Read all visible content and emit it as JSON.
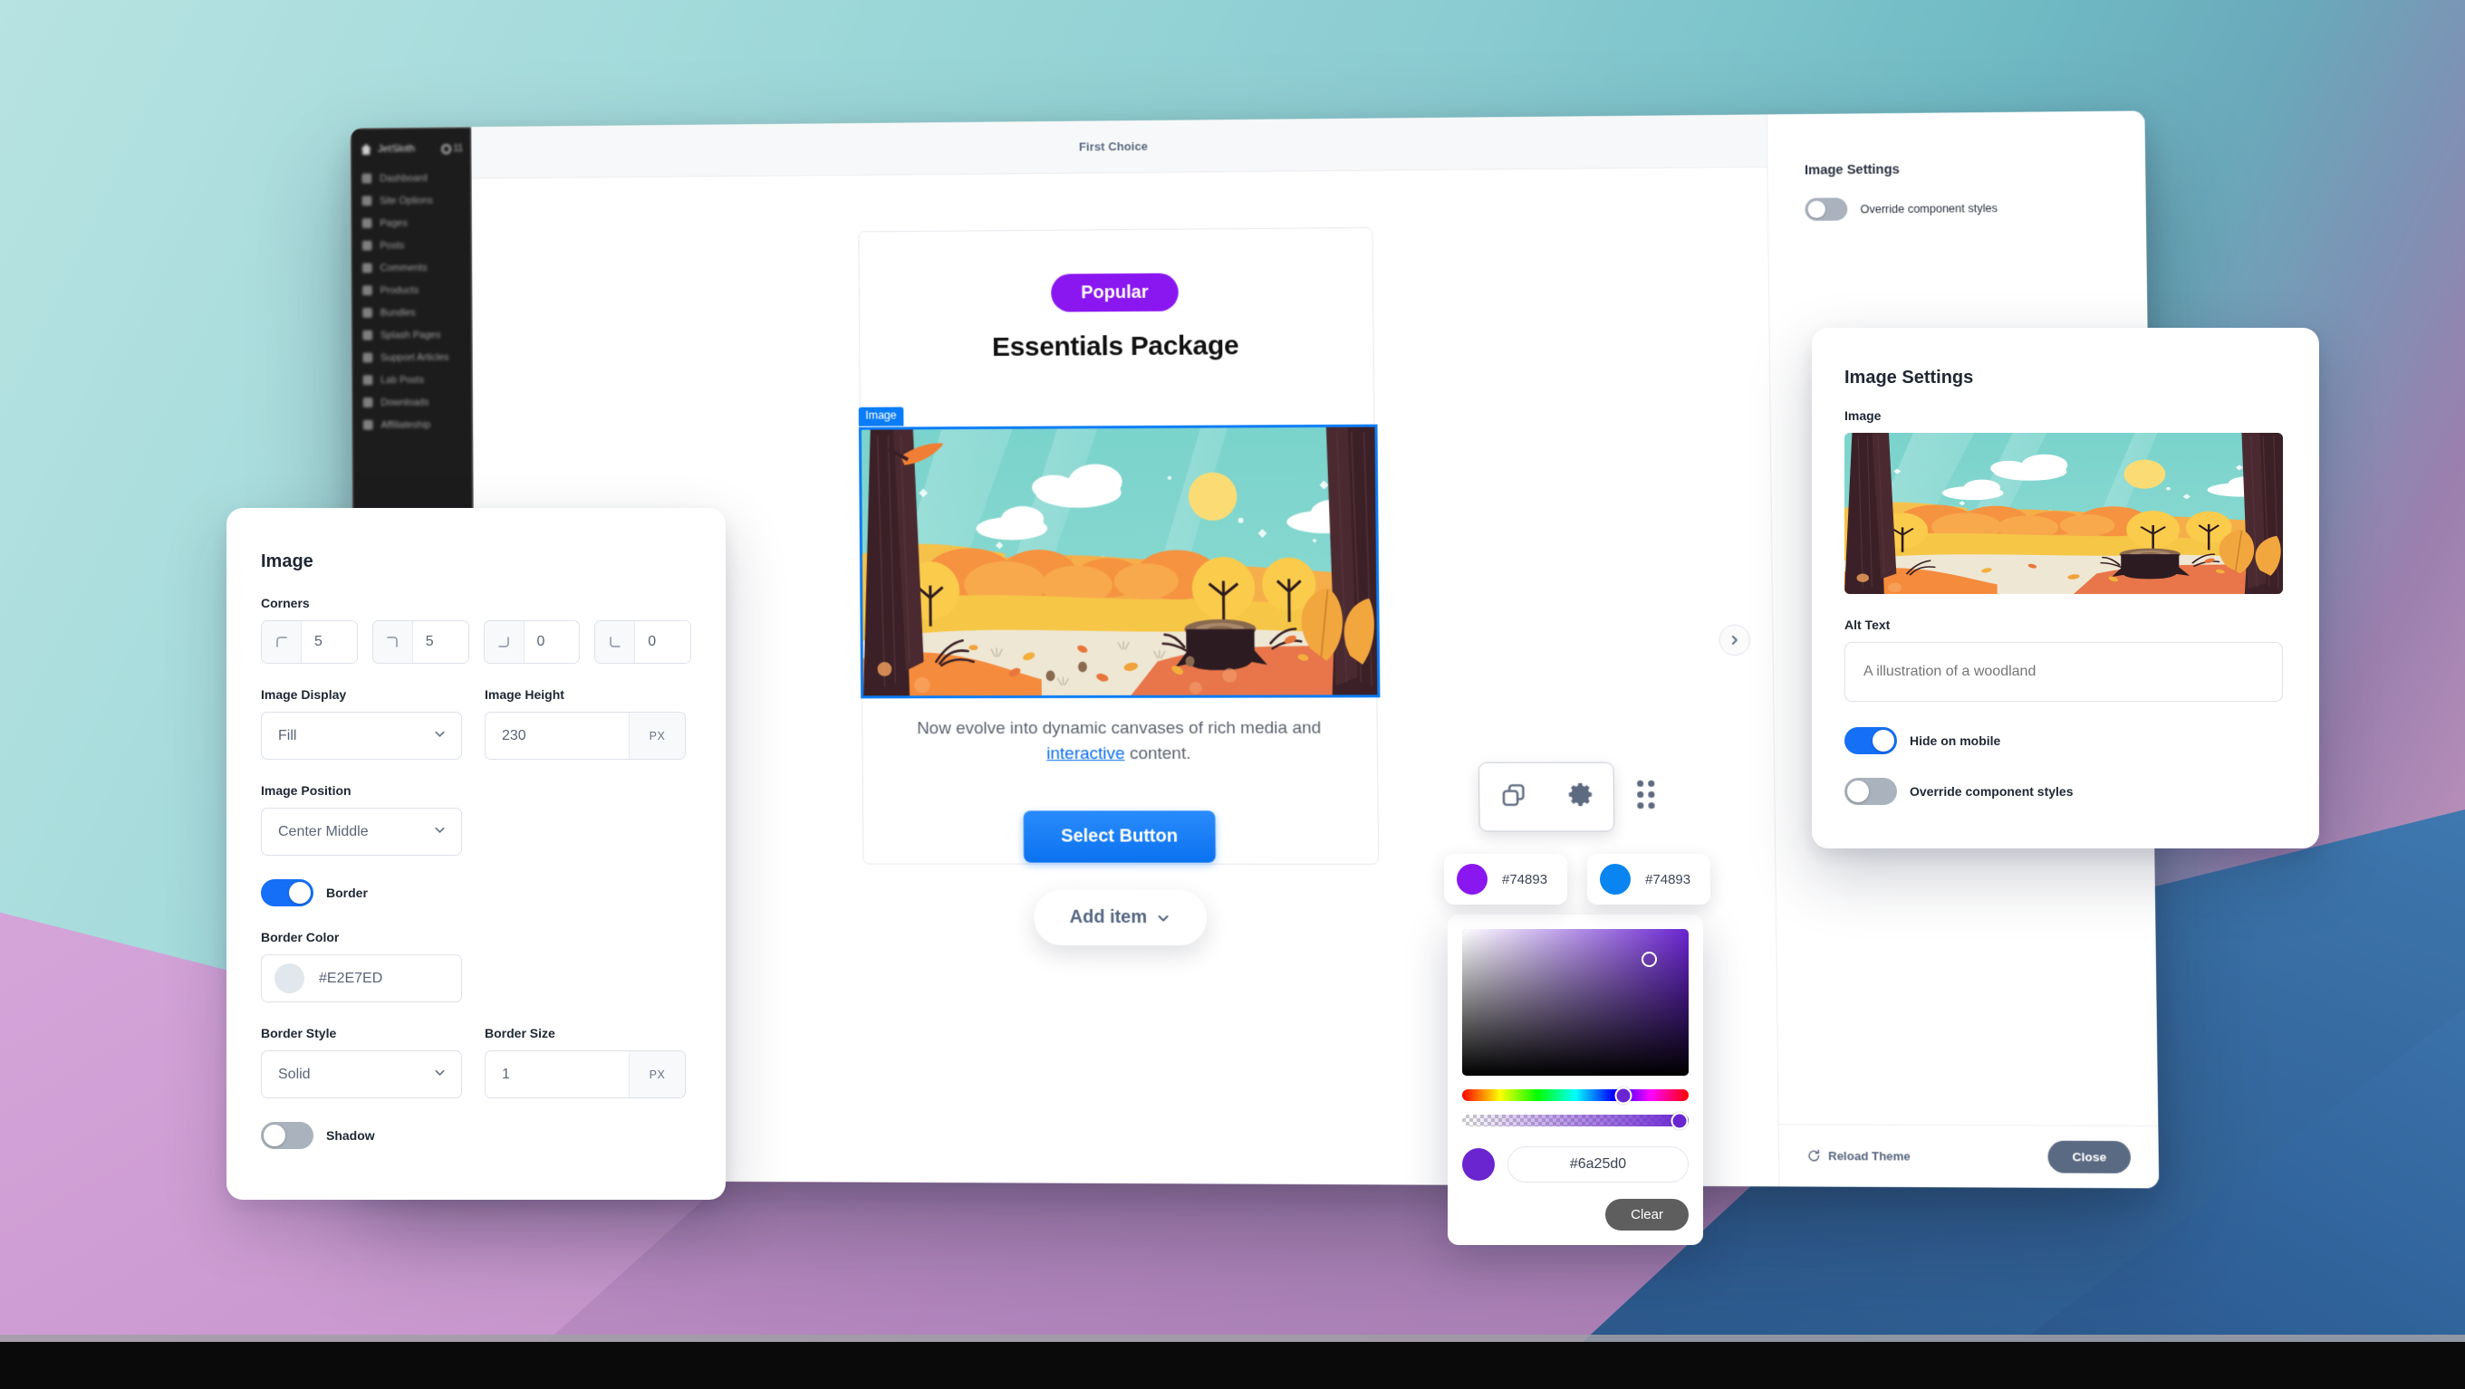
{
  "sidebar": {
    "brand": "JetSloth",
    "notification_count": "11",
    "items": [
      {
        "label": "Dashboard",
        "icon": "dashboard-icon"
      },
      {
        "label": "Site Options",
        "icon": "gear-icon"
      },
      {
        "label": "Pages",
        "icon": "page-icon"
      },
      {
        "label": "Posts",
        "icon": "pencil-icon"
      },
      {
        "label": "Comments",
        "icon": "comment-icon"
      },
      {
        "label": "Products",
        "icon": "cart-icon"
      },
      {
        "label": "Bundles",
        "icon": "box-icon"
      },
      {
        "label": "Splash Pages",
        "icon": "columns-icon"
      },
      {
        "label": "Support Articles",
        "icon": "lifebuoy-icon"
      },
      {
        "label": "Lab Posts",
        "icon": "flask-icon"
      },
      {
        "label": "Downloads",
        "icon": "download-icon"
      },
      {
        "label": "Affiliateship",
        "icon": "person-icon"
      }
    ]
  },
  "canvas": {
    "header_title": "First Choice",
    "card": {
      "badge": "Popular",
      "title": "Essentials Package",
      "image_tag": "Image",
      "body_before_link": "Now evolve into dynamic canvases of rich media and ",
      "body_link": "interactive",
      "body_after_link": " content.",
      "button": "Select Button"
    },
    "add_item": "Add item",
    "add_item_chevron": "chevron-down-icon",
    "trash_icon": "trash-icon",
    "pager_icon": "chevron-right-icon",
    "toolbar": {
      "copy_icon": "copy-icon",
      "settings_icon": "gear-icon",
      "drag_handle_icon": "drag-dots-icon"
    }
  },
  "rail": {
    "title": "Image Settings",
    "override_toggle": {
      "label": "Override component styles",
      "state": "off"
    },
    "reload_theme": "Reload Theme",
    "reload_icon": "refresh-icon",
    "close": "Close"
  },
  "image_panel": {
    "title": "Image",
    "corners_label": "Corners",
    "corners": [
      {
        "icon": "corner-top-left-icon",
        "value": "5"
      },
      {
        "icon": "corner-top-right-icon",
        "value": "5"
      },
      {
        "icon": "corner-bottom-right-icon",
        "value": "0"
      },
      {
        "icon": "corner-bottom-left-icon",
        "value": "0"
      }
    ],
    "image_display_label": "Image Display",
    "image_display_value": "Fill",
    "image_height_label": "Image Height",
    "image_height_value": "230",
    "image_height_unit": "PX",
    "image_position_label": "Image Position",
    "image_position_value": "Center Middle",
    "border_toggle": {
      "label": "Border",
      "state": "on"
    },
    "border_color_label": "Border Color",
    "border_color_value": "#E2E7ED",
    "border_style_label": "Border Style",
    "border_style_value": "Solid",
    "border_size_label": "Border Size",
    "border_size_value": "1",
    "border_size_unit": "PX",
    "shadow_toggle": {
      "label": "Shadow",
      "state": "off"
    }
  },
  "image_settings_panel": {
    "title": "Image Settings",
    "image_label": "Image",
    "alt_text_label": "Alt Text",
    "alt_text_value": "A illustration of a woodland",
    "hide_on_mobile": {
      "label": "Hide on mobile",
      "state": "on"
    },
    "override_styles": {
      "label": "Override component styles",
      "state": "off"
    }
  },
  "color_picker": {
    "swatches": [
      {
        "color": "#8A17F0",
        "label": "#74893"
      },
      {
        "color": "#0A84F0",
        "label": "#74893"
      }
    ],
    "hex_value": "#6a25d0",
    "current_color": "#6a25d0",
    "clear_label": "Clear"
  },
  "colors": {
    "accent_blue": "#156FF7",
    "accent_purple": "#8A17F0",
    "picker_purple": "#6a25d0",
    "border_color": "#E2E7ED",
    "toggle_off": "#aab2bd"
  }
}
